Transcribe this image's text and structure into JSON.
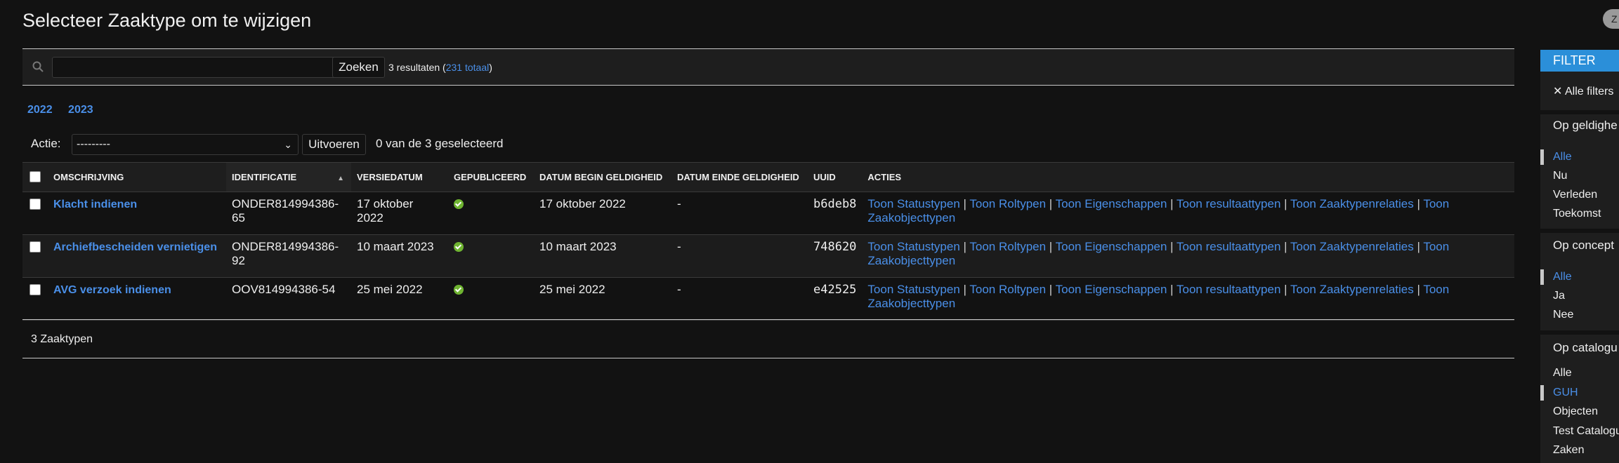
{
  "header": {
    "title": "Selecteer Zaaktype om te wijzigen",
    "avatar_initial": "Z"
  },
  "search": {
    "placeholder": "",
    "button_label": "Zoeken",
    "results_prefix": "3 resultaten (",
    "results_total_link": "231 totaal",
    "results_suffix": ")"
  },
  "date_hierarchy": [
    "2022",
    "2023"
  ],
  "actions": {
    "label": "Actie:",
    "selected_option": "---------",
    "run_button": "Uitvoeren",
    "selection_count": "0 van de 3 geselecteerd"
  },
  "table": {
    "columns": [
      "Omschrijving",
      "Identificatie",
      "Versiedatum",
      "Gepubliceerd",
      "Datum begin geldigheid",
      "Datum einde geldigheid",
      "UUID",
      "Acties"
    ],
    "rows": [
      {
        "omschrijving": "Klacht indienen",
        "identificatie": "ONDER814994386-65",
        "versiedatum": "17 oktober 2022",
        "begin": "17 oktober 2022",
        "einde": "-",
        "uuid": "b6deb8"
      },
      {
        "omschrijving": "Archiefbescheiden vernietigen",
        "identificatie": "ONDER814994386-92",
        "versiedatum": "10 maart 2023",
        "begin": "10 maart 2023",
        "einde": "-",
        "uuid": "748620"
      },
      {
        "omschrijving": "AVG verzoek indienen",
        "identificatie": "OOV814994386-54",
        "versiedatum": "25 mei 2022",
        "begin": "25 mei 2022",
        "einde": "-",
        "uuid": "e42525"
      }
    ],
    "action_links": [
      "Toon Statustypen",
      "Toon Roltypen",
      "Toon Eigenschappen",
      "Toon resultaattypen",
      "Toon Zaaktypenrelaties",
      "Toon Zaakobjecttypen"
    ],
    "separator": "|",
    "footer": "3 Zaaktypen"
  },
  "filter": {
    "title": "FILTER",
    "clear_all": "✕ Alle filters",
    "groups": [
      {
        "title": "Op geldighe",
        "options": [
          "Alle",
          "Nu",
          "Verleden",
          "Toekomst"
        ],
        "selected": 0
      },
      {
        "title": "Op concept",
        "options": [
          "Alle",
          "Ja",
          "Nee"
        ],
        "selected": 0
      },
      {
        "title": "Op catalogu",
        "options": [
          "Alle",
          "GUH",
          "Objecten",
          "Test Catalogu",
          "Zaken"
        ],
        "selected": 1
      }
    ]
  },
  "colors": {
    "background": "#121212",
    "link": "#4a8fe8",
    "filter_header": "#2b8fd9",
    "published_check": "#6fb431"
  }
}
